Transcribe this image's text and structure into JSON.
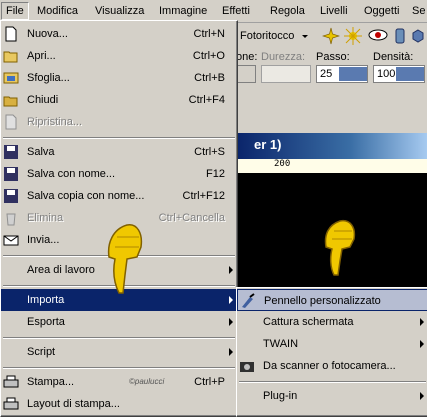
{
  "menubar": {
    "items": [
      "File",
      "Modifica",
      "Visualizza",
      "Immagine",
      "Effetti",
      "Regola",
      "Livelli",
      "Oggetti",
      "Se"
    ]
  },
  "toolbar": {
    "tool_label": "Fotoritocco"
  },
  "options": {
    "labels": [
      "one:",
      "Durezza:",
      "Passo:",
      "Densità:"
    ],
    "values": [
      "",
      "",
      "25",
      "100"
    ]
  },
  "window": {
    "title_fragment": "er 1)",
    "ruler_label": "200"
  },
  "file_menu": {
    "items": [
      {
        "label": "Nuova...",
        "shortcut": "Ctrl+N",
        "icon": "new-document-icon",
        "disabled": false
      },
      {
        "label": "Apri...",
        "shortcut": "Ctrl+O",
        "icon": "open-folder-icon",
        "disabled": false
      },
      {
        "label": "Sfoglia...",
        "shortcut": "Ctrl+B",
        "icon": "browse-icon",
        "disabled": false
      },
      {
        "label": "Chiudi",
        "shortcut": "Ctrl+F4",
        "icon": "close-folder-icon",
        "disabled": false
      },
      {
        "label": "Ripristina...",
        "shortcut": "",
        "icon": "revert-icon",
        "disabled": true
      },
      {
        "label": "Salva",
        "shortcut": "Ctrl+S",
        "icon": "save-icon",
        "disabled": false
      },
      {
        "label": "Salva con nome...",
        "shortcut": "F12",
        "icon": "save-as-icon",
        "disabled": false
      },
      {
        "label": "Salva copia con nome...",
        "shortcut": "Ctrl+F12",
        "icon": "save-copy-icon",
        "disabled": false
      },
      {
        "label": "Elimina",
        "shortcut": "Ctrl+Cancella",
        "icon": "trash-icon",
        "disabled": true
      },
      {
        "label": "Invia...",
        "shortcut": "",
        "icon": "send-icon",
        "disabled": false
      },
      {
        "label": "Area di lavoro",
        "shortcut": "",
        "icon": "",
        "disabled": false
      },
      {
        "label": "Importa",
        "shortcut": "",
        "icon": "",
        "disabled": false
      },
      {
        "label": "Esporta",
        "shortcut": "",
        "icon": "",
        "disabled": false
      },
      {
        "label": "Script",
        "shortcut": "",
        "icon": "",
        "disabled": false
      },
      {
        "label": "Stampa...",
        "shortcut": "Ctrl+P",
        "icon": "print-icon",
        "disabled": false
      },
      {
        "label": "Layout di stampa...",
        "shortcut": "",
        "icon": "print-layout-icon",
        "disabled": false
      }
    ]
  },
  "import_menu": {
    "items": [
      {
        "label": "Pennello personalizzato",
        "icon": "brush-icon"
      },
      {
        "label": "Cattura schermata",
        "icon": ""
      },
      {
        "label": "TWAIN",
        "icon": ""
      },
      {
        "label": "Da scanner o fotocamera...",
        "icon": "camera-icon"
      },
      {
        "label": "Plug-in",
        "icon": ""
      }
    ]
  },
  "watermark": "©paulucci"
}
